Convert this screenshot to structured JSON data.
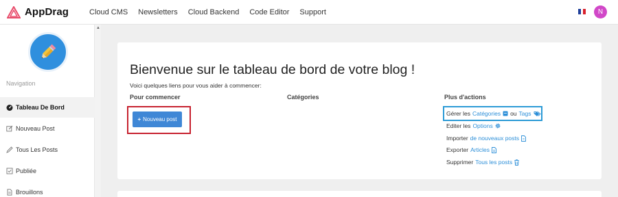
{
  "brand": {
    "name": "AppDrag",
    "color": "#e84b6a"
  },
  "topnav": [
    "Cloud CMS",
    "Newsletters",
    "Cloud Backend",
    "Code Editor",
    "Support"
  ],
  "user": {
    "initial": "N",
    "avatar_color": "#d147c8",
    "flag_icon": "france-flag-icon"
  },
  "sidebar": {
    "heading": "Navigation",
    "logo_icon": "pencil-icon",
    "items": [
      {
        "label": "Tableau De Bord",
        "icon": "dashboard-icon",
        "active": true
      },
      {
        "label": "Nouveau Post",
        "icon": "edit-icon"
      },
      {
        "label": "Tous Les Posts",
        "icon": "pencil-icon"
      },
      {
        "label": "Publiée",
        "icon": "check-square-icon"
      },
      {
        "label": "Brouillons",
        "icon": "document-icon"
      }
    ]
  },
  "main": {
    "title": "Bienvenue sur le tableau de bord de votre blog !",
    "subtitle": "Voici quelques liens pour vous aider à commencer:",
    "col_start": "Pour commencer",
    "col_categories": "Catégories",
    "col_more": "Plus d'actions",
    "new_post_icon": "+",
    "new_post_label": "Nouveau post",
    "actions": {
      "manage": {
        "prefix": "Gérer les",
        "link1": "Catégories",
        "middle": "ou",
        "link2": "Tags"
      },
      "edit": {
        "prefix": "Editer les",
        "link": "Options"
      },
      "import": {
        "prefix": "Importer",
        "link": "de nouveaux posts"
      },
      "export": {
        "prefix": "Exporter",
        "link": "Articles"
      },
      "delete": {
        "prefix": "Supprimer",
        "link": "Tous les posts"
      }
    }
  },
  "colors": {
    "accent": "#2d8fd8",
    "button": "#3f87d6",
    "highlight_red": "#c6202e",
    "highlight_blue": "#2a9ad6"
  }
}
